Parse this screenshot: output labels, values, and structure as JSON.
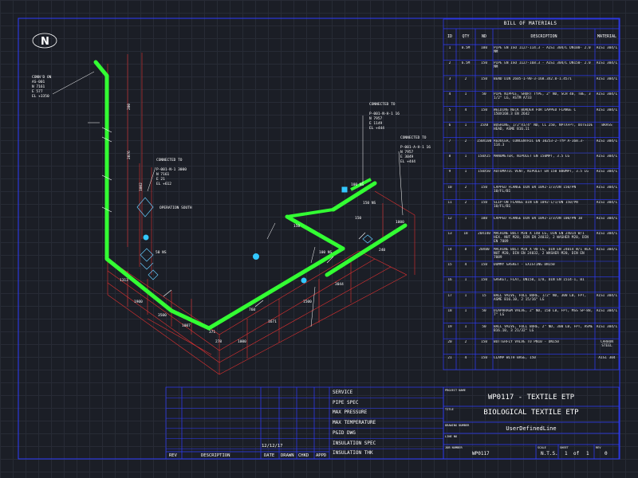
{
  "drawing": {
    "north_label": "N",
    "conn_left_top": [
      "CONN'D ON",
      "AS-001",
      "N 7161",
      "E 577",
      "EL +3350"
    ],
    "connected_mid": [
      "CONNECTED TO",
      "P-001-N-1 3000",
      "N 7161",
      "E 21",
      "EL +612"
    ],
    "operation_south": "OPERATION SOUTH",
    "connected_right1": [
      "CONNECTED TO",
      "P-001-N-H-1 16",
      "N 7957",
      "E 1149",
      "EL +444"
    ],
    "connected_right2": [
      "CONNECTED TO",
      "P-001-A-H-1 16",
      "N 7957",
      "E 3049",
      "EL +444"
    ],
    "dimensions": [
      "200",
      "2076",
      "1002",
      "1313",
      "1900",
      "3500",
      "1007",
      "371",
      "1000",
      "1671",
      "1500",
      "3044",
      "278",
      "240",
      "150",
      "1000",
      "760",
      "150"
    ],
    "tags": [
      "100 NS",
      "150 NS",
      "50 NS",
      "100 NS"
    ]
  },
  "bom": {
    "title": "BILL OF MATERIALS",
    "headers": [
      "ID",
      "QTY",
      "ND",
      "DESCRIPTION",
      "MATERIAL"
    ],
    "rows": [
      {
        "id": "1",
        "qty": "0.5M",
        "nd": "100",
        "desc": "PIPE EN ISO 1127-114.3 - AISI 304/L DN100- 2.0 MM",
        "mat": "AISI 304/L"
      },
      {
        "id": "2",
        "qty": "6.5M",
        "nd": "150",
        "desc": "PIPE EN ISO 1127-168.3 - AISI 304/L DN150- 2.0 MM",
        "mat": "AISI 304/L"
      },
      {
        "id": "3",
        "qty": "2",
        "nd": "150",
        "desc": "BEND DIN 2605-1-90-3-168.3X2.0-1.4571",
        "mat": "AISI 304/L"
      },
      {
        "id": "4",
        "qty": "1",
        "nd": "50",
        "desc": "PIPE NIPPLE, SHORT TYPE, 2\" ND, SCH 40, TBE, 3 1/2\" LG, ASTM A733",
        "mat": "AISI 304/L"
      },
      {
        "id": "5",
        "qty": "4",
        "nd": "150",
        "desc": "WELDING NECK BORDER FOR LAPPED FLANGE C 150X168.3 EN 2642",
        "mat": "AISI 304/L"
      },
      {
        "id": "6",
        "qty": "1",
        "nd": "15X8",
        "desc": "BUSHING, 1/2\"X1/4\" ND, CL 250, NPTXFPT, OUTSIDE HEAD, ASME B16.11",
        "mat": "BRASS"
      },
      {
        "id": "7",
        "qty": "2",
        "nd": "150X100",
        "desc": "REDUCER, CONCENTRIC EN 10253-2-TYP A-168.3-114.3",
        "mat": "AISI 304/L"
      },
      {
        "id": "8",
        "qty": "1",
        "nd": "150X15",
        "desc": "MANOMETER, NIPOLET EN 150MPT, 3.5 LG",
        "mat": "AISI 304/L"
      },
      {
        "id": "9",
        "qty": "1",
        "nd": "150X50",
        "desc": "AUTOMATIC VENT, NIPOLET EN 150 B80MPT, 3.5 LG",
        "mat": "AISI 304/L"
      },
      {
        "id": "10",
        "qty": "2",
        "nd": "150",
        "desc": "LAPPED FLANGE DIN EN 1092-1/3/DN 150/PN 10/FL/B1",
        "mat": "AISI 304/L"
      },
      {
        "id": "11",
        "qty": "2",
        "nd": "150",
        "desc": "SLIP-ON FLANGE DIN EN 1092-1/1/DN 150/PN 10/FL/B1",
        "mat": "AISI 304/L"
      },
      {
        "id": "12",
        "qty": "1",
        "nd": "100",
        "desc": "LAPPED FLANGE DIN EN 1092-1/3/DN 100/PN 10",
        "mat": "AISI 304/L"
      },
      {
        "id": "13",
        "qty": "18",
        "nd": "20X140",
        "desc": "MACHINE BOLT M20 X 140 LG, DIN EN 24014 W/1 HEX. NUT M20, DIN EN 24032, 2 WASHER M20, DIN EN 7089",
        "mat": "AISI 304/L"
      },
      {
        "id": "14",
        "qty": "8",
        "nd": "20X00",
        "desc": "MACHINE BOLT M20 X 90 LG, DIN EN 24014 W/1 HEX. NUT M20, DIN EN 24032, 2 WASHER M20, DIN EN 7089",
        "mat": "AISI 304/L"
      },
      {
        "id": "15",
        "qty": "4",
        "nd": "150",
        "desc": "DUMMY GASKET - EXISTING DN150",
        "mat": ""
      },
      {
        "id": "16",
        "qty": "1",
        "nd": "150",
        "desc": "GASKET, FLAT, DN150, 1/8, DIN EN 1514-1, B1",
        "mat": ""
      },
      {
        "id": "17",
        "qty": "1",
        "nd": "15",
        "desc": "BALL VALVE, FULL BORE, 1/2\" ND, 300 LB, FPT, ASME B16.10, 2 15/16\" LG",
        "mat": "AISI 304/L"
      },
      {
        "id": "18",
        "qty": "1",
        "nd": "50",
        "desc": "DIAPHRAGM VALVE, 2\" ND, 150 LB, FPT, MSS SP-88, 7\" LG",
        "mat": "AISI 304/L"
      },
      {
        "id": "19",
        "qty": "1",
        "nd": "50",
        "desc": "BALL VALVE, FULL BORE, 2\" ND, 300 LB, FPT, ASME B16.10, 3 21/32\" LG",
        "mat": "AISI 304/L"
      },
      {
        "id": "20",
        "qty": "2",
        "nd": "150",
        "desc": "BUTTERFLY VALVE TO PN10 - DN150",
        "mat": "CARBON STEEL"
      },
      {
        "id": "21",
        "qty": "4",
        "nd": "150",
        "desc": "CLAMP WITH BASE, 150",
        "mat": "AISI 304"
      }
    ]
  },
  "title_block": {
    "project_name_label": "PROJECT NAME",
    "project_name": "WP0117 - TEXTILE ETP",
    "title_label": "TITLE",
    "title": "BIOLOGICAL TEXTILE ETP",
    "drawing_number_label": "DRAWING NUMBER",
    "drawing_number": "UserDefinedLine",
    "line_no_label": "LINE NO",
    "job_number_label": "JOB NUMBER",
    "job_number": "WP0117",
    "scale_label": "SCALE",
    "scale": "N.T.S.",
    "sheet_label": "SHEET",
    "sheet": "1",
    "of_label": "of",
    "sheets": "1",
    "rev_label": "REV",
    "rev": "0"
  },
  "service_block": {
    "labels": [
      "SERVICE",
      "PIPE SPEC",
      "MAX PRESSURE",
      "MAX TEMPERATURE",
      "P&ID DWG",
      "INSULATION SPEC",
      "INSULATION THK"
    ]
  },
  "revision_block": {
    "date_value": "12/12/17",
    "headers": [
      "REV",
      "DESCRIPTION",
      "DATE",
      "DRAWN",
      "CHKD",
      "APPD"
    ]
  }
}
